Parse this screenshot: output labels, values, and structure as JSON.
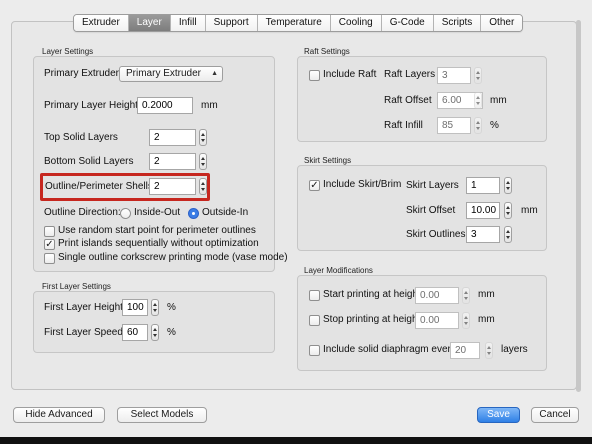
{
  "tabs": [
    "Extruder",
    "Layer",
    "Infill",
    "Support",
    "Temperature",
    "Cooling",
    "G-Code",
    "Scripts",
    "Other"
  ],
  "active_tab": "Layer",
  "layer_settings": {
    "title": "Layer Settings",
    "primary_extruder_label": "Primary Extruder",
    "primary_extruder_value": "Primary Extruder",
    "primary_layer_height_label": "Primary Layer Height",
    "primary_layer_height_value": "0.2000",
    "primary_layer_height_unit": "mm",
    "top_solid_layers_label": "Top Solid Layers",
    "top_solid_layers_value": "2",
    "bottom_solid_layers_label": "Bottom Solid Layers",
    "bottom_solid_layers_value": "2",
    "outline_shells_label": "Outline/Perimeter Shells",
    "outline_shells_value": "2",
    "outline_direction_label": "Outline Direction:",
    "inside_out_label": "Inside-Out",
    "outside_in_label": "Outside-In",
    "outline_direction_selected": "Outside-In",
    "random_start_label": "Use random start point for perimeter outlines",
    "random_start_checked": false,
    "print_islands_label": "Print islands sequentially without optimization",
    "print_islands_checked": true,
    "vase_mode_label": "Single outline corkscrew printing mode (vase mode)",
    "vase_mode_checked": false
  },
  "first_layer_settings": {
    "title": "First Layer Settings",
    "height_label": "First Layer Height",
    "height_value": "100",
    "height_unit": "%",
    "speed_label": "First Layer Speed",
    "speed_value": "60",
    "speed_unit": "%"
  },
  "raft_settings": {
    "title": "Raft Settings",
    "include_raft_label": "Include Raft",
    "include_raft_checked": false,
    "raft_layers_label": "Raft Layers",
    "raft_layers_value": "3",
    "raft_offset_label": "Raft Offset",
    "raft_offset_value": "6.00",
    "raft_offset_unit": "mm",
    "raft_infill_label": "Raft Infill",
    "raft_infill_value": "85",
    "raft_infill_unit": "%"
  },
  "skirt_settings": {
    "title": "Skirt Settings",
    "include_skirt_label": "Include Skirt/Brim",
    "include_skirt_checked": true,
    "skirt_layers_label": "Skirt Layers",
    "skirt_layers_value": "1",
    "skirt_offset_label": "Skirt Offset",
    "skirt_offset_value": "10.00",
    "skirt_offset_unit": "mm",
    "skirt_outlines_label": "Skirt Outlines",
    "skirt_outlines_value": "3"
  },
  "layer_modifications": {
    "title": "Layer Modifications",
    "start_label": "Start printing at height",
    "start_value": "0.00",
    "start_unit": "mm",
    "stop_label": "Stop printing at height",
    "stop_value": "0.00",
    "stop_unit": "mm",
    "diaphragm_label": "Include solid diaphragm every",
    "diaphragm_value": "20",
    "diaphragm_unit": "layers"
  },
  "footer": {
    "hide_advanced": "Hide Advanced",
    "select_models": "Select Models",
    "save": "Save",
    "cancel": "Cancel"
  },
  "colors": {
    "highlight_box": "#c6271f",
    "primary_button": "#2f80e6",
    "active_tab": "#8a8a8a"
  }
}
